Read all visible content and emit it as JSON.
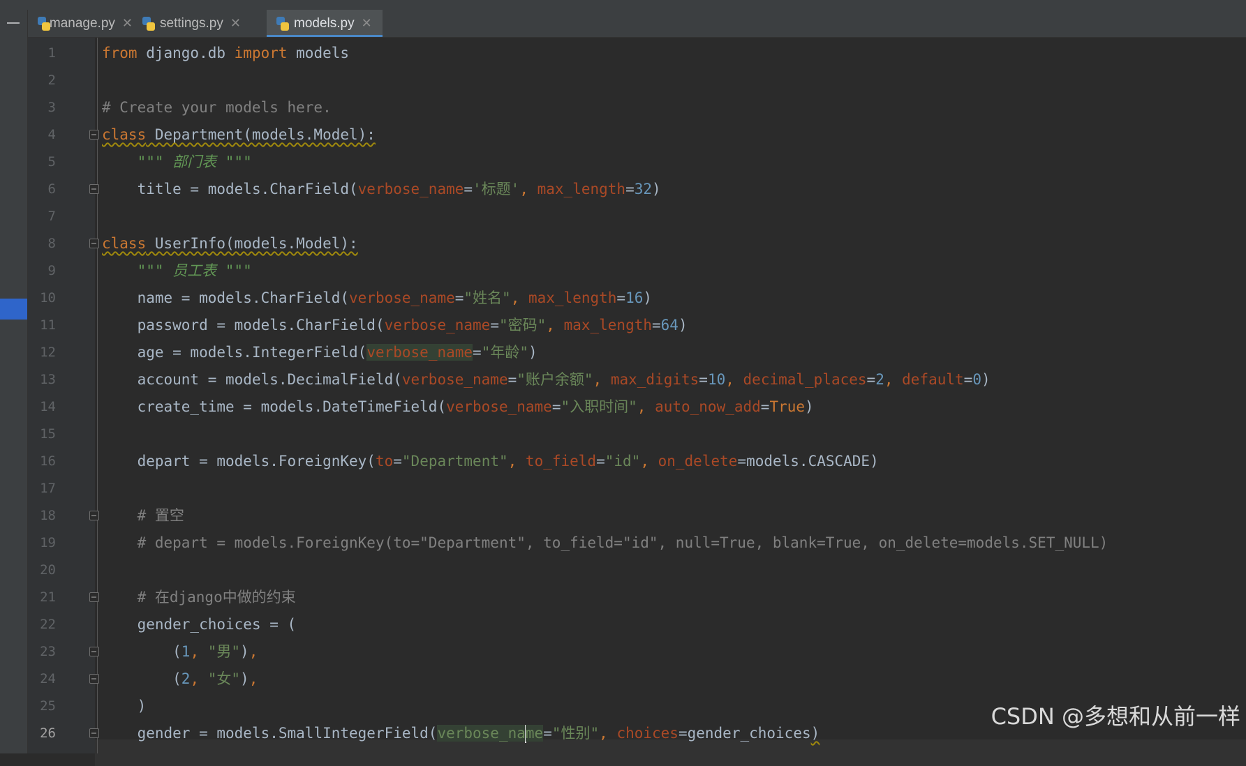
{
  "tabs": [
    {
      "label": "manage.py",
      "active": false
    },
    {
      "label": "settings.py",
      "active": false
    },
    {
      "label": "models.py",
      "active": true
    }
  ],
  "line_numbers": [
    "1",
    "2",
    "3",
    "4",
    "5",
    "6",
    "7",
    "8",
    "9",
    "10",
    "11",
    "12",
    "13",
    "14",
    "15",
    "16",
    "17",
    "18",
    "19",
    "20",
    "21",
    "22",
    "23",
    "24",
    "25",
    "26"
  ],
  "current_line": "26",
  "code": {
    "l1": {
      "kw1": "from",
      "t1": " django.db ",
      "kw2": "import",
      "t2": " models"
    },
    "l3": {
      "comment": "# Create your models here."
    },
    "l4": {
      "kw": "class",
      "t": " Department(models.Model):"
    },
    "l5": {
      "doc": "\"\"\" 部门表 \"\"\""
    },
    "l6": {
      "t1": "title = models.CharField(",
      "p1": "verbose_name",
      "s1": "'标题'",
      "p2": "max_length",
      "n1": "32",
      "t2": ")"
    },
    "l8": {
      "kw": "class",
      "t": " UserInfo(models.Model):"
    },
    "l9": {
      "doc": "\"\"\" 员工表 \"\"\""
    },
    "l10": {
      "t1": "name = models.CharField(",
      "p1": "verbose_name",
      "s1": "\"姓名\"",
      "p2": "max_length",
      "n1": "16",
      "t2": ")"
    },
    "l11": {
      "t1": "password = models.CharField(",
      "p1": "verbose_name",
      "s1": "\"密码\"",
      "p2": "max_length",
      "n1": "64",
      "t2": ")"
    },
    "l12": {
      "t1": "age = models.IntegerField(",
      "p1": "verbose_name",
      "s1": "\"年龄\"",
      "t2": ")"
    },
    "l13": {
      "t1": "account = models.DecimalField(",
      "p1": "verbose_name",
      "s1": "\"账户余额\"",
      "p2": "max_digits",
      "n1": "10",
      "p3": "decimal_places",
      "n2": "2",
      "p4": "default",
      "n3": "0",
      "t2": ")"
    },
    "l14": {
      "t1": "create_time = models.DateTimeField(",
      "p1": "verbose_name",
      "s1": "\"入职时间\"",
      "p2": "auto_now_add",
      "kw": "True",
      "t2": ")"
    },
    "l16": {
      "t1": "depart = models.ForeignKey(",
      "p1": "to",
      "s1": "\"Department\"",
      "p2": "to_field",
      "s2": "\"id\"",
      "p3": "on_delete",
      "t2": "models.CASCADE)"
    },
    "l18": {
      "comment": "# 置空"
    },
    "l19": {
      "comment": "# depart = models.ForeignKey(to=\"Department\", to_field=\"id\", null=True, blank=True, on_delete=models.SET_NULL)"
    },
    "l21": {
      "comment": "# 在django中做的约束"
    },
    "l22": {
      "t": "gender_choices = ("
    },
    "l23": {
      "n": "1",
      "s": "\"男\""
    },
    "l24": {
      "n": "2",
      "s": "\"女\""
    },
    "l25": {
      "t": ")"
    },
    "l26": {
      "t1": "gender = models.SmallIntegerField(",
      "p1a": "verbose_na",
      "p1b": "me",
      "s1": "\"性别\"",
      "p2": "choices",
      "t2": "gender_choices",
      "t3": ")"
    }
  },
  "watermark": "CSDN @多想和从前一样",
  "colors": {
    "background": "#2b2b2b",
    "keyword": "#cc7832",
    "string": "#6a8759",
    "number": "#6897bb",
    "param": "#aa4926",
    "comment": "#808080"
  }
}
